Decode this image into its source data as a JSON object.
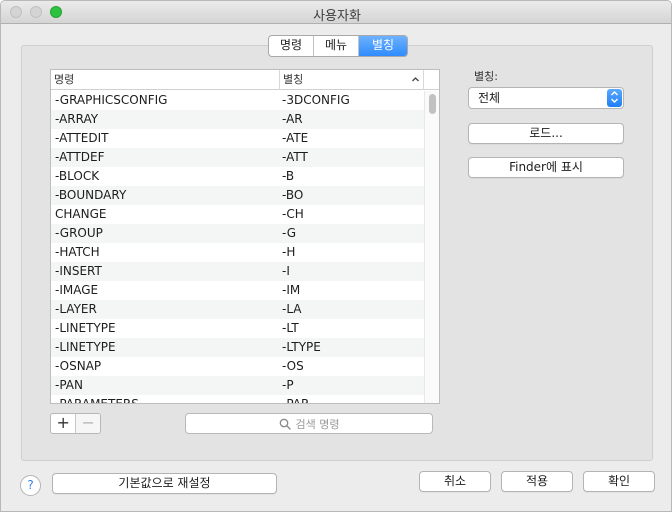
{
  "window": {
    "title": "사용자화"
  },
  "tabs": [
    {
      "label": "명령",
      "active": false
    },
    {
      "label": "메뉴",
      "active": false
    },
    {
      "label": "별칭",
      "active": true
    }
  ],
  "table": {
    "columns": [
      "명령",
      "별칭"
    ],
    "rows": [
      [
        "-GRAPHICSCONFIG",
        "-3DCONFIG"
      ],
      [
        "-ARRAY",
        "-AR"
      ],
      [
        "-ATTEDIT",
        "-ATE"
      ],
      [
        "-ATTDEF",
        "-ATT"
      ],
      [
        "-BLOCK",
        "-B"
      ],
      [
        "-BOUNDARY",
        "-BO"
      ],
      [
        "CHANGE",
        "-CH"
      ],
      [
        "-GROUP",
        "-G"
      ],
      [
        "-HATCH",
        "-H"
      ],
      [
        "-INSERT",
        "-I"
      ],
      [
        "-IMAGE",
        "-IM"
      ],
      [
        "-LAYER",
        "-LA"
      ],
      [
        "-LINETYPE",
        "-LT"
      ],
      [
        "-LINETYPE",
        "-LTYPE"
      ],
      [
        "-OSNAP",
        "-OS"
      ],
      [
        "-PAN",
        "-P"
      ],
      [
        "-PARAMETERS",
        "-PAR"
      ]
    ]
  },
  "list_controls": {
    "add": "+",
    "remove": "−"
  },
  "search": {
    "placeholder": "검색 명령"
  },
  "alias_filter": {
    "label": "별칭:",
    "value": "전체"
  },
  "buttons": {
    "load": "로드...",
    "finder": "Finder에 표시",
    "defaults": "기본값으로 재설정",
    "cancel": "취소",
    "apply": "적용",
    "ok": "확인",
    "help": "?"
  },
  "colors": {
    "accent": "#2f8bfd",
    "zoom": "#2ec241"
  }
}
